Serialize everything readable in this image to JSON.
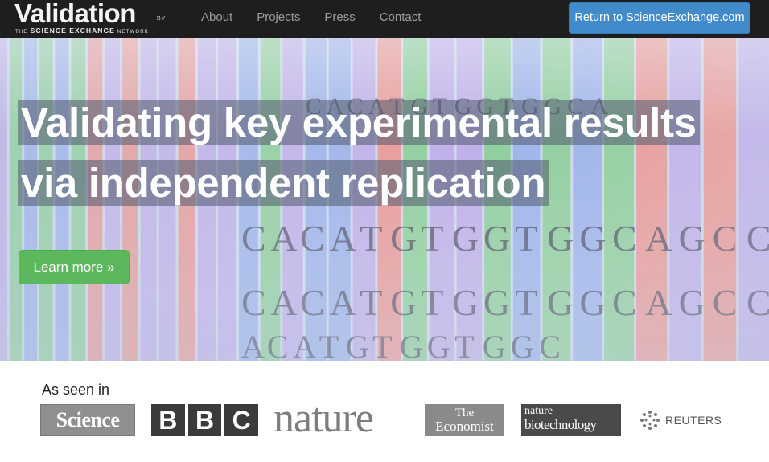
{
  "navbar": {
    "brand": {
      "main": "Validation",
      "by": "BY",
      "sub_the": "THE",
      "sub_name": "SCIENCE EXCHANGE",
      "sub_network": "NETWORK"
    },
    "links": [
      "About",
      "Projects",
      "Press",
      "Contact"
    ],
    "return_label": "Return to ScienceExchange.com"
  },
  "hero": {
    "headline_line1": "Validating key experimental results",
    "headline_line2": "via independent replication",
    "learn_more_label": "Learn more »",
    "dna_rows": [
      "CACATGTGGTGGCA",
      "CACATGTGGTGGCAGCCGT",
      "CACATGTGGTGGCAGCCGT",
      "ACATGTGGTGGC"
    ]
  },
  "press": {
    "label": "As seen in",
    "science": "Science",
    "bbc": [
      "B",
      "B",
      "C"
    ],
    "nature": "nature",
    "economist_line1": "The",
    "economist_line2": "Economist",
    "natbio_line1": "nature",
    "natbio_line2": "biotechnology",
    "reuters": "REUTERS"
  },
  "colors": {
    "navbar_bg": "#1e1e1e",
    "primary_button": "#428bca",
    "success_button": "#5cb85c"
  }
}
